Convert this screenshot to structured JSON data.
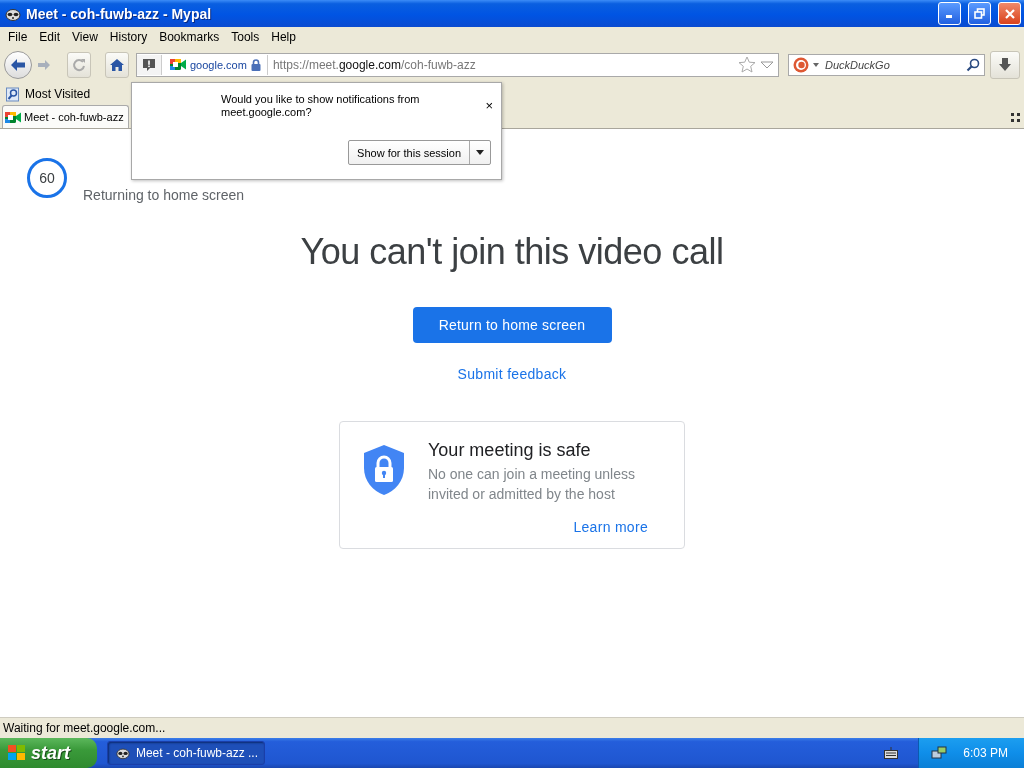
{
  "window": {
    "title": "Meet - coh-fuwb-azz - Mypal"
  },
  "menu": [
    "File",
    "Edit",
    "View",
    "History",
    "Bookmarks",
    "Tools",
    "Help"
  ],
  "navigation": {
    "identity": "google.com",
    "url": "https://meet.**google.com**/coh-fuwb-azz",
    "search": {
      "placeholder": "DuckDuckGo"
    }
  },
  "bookmarks": [
    "Most Visited"
  ],
  "tabs": [
    {
      "label": "Meet - coh-fuwb-azz",
      "selected": true
    }
  ],
  "notification_popup": {
    "message": "Would you like to show notifications from meet.google.com?",
    "close": "×",
    "button": "Show for this session"
  },
  "page": {
    "countdown": "60",
    "countdown_label": "Returning to home screen",
    "heading": "You can't join this video call",
    "primary_button": "Return to home screen",
    "feedback_link": "Submit feedback",
    "card": {
      "title": "Your meeting is safe",
      "body": "No one can join a meeting unless invited or admitted by the host",
      "link": "Learn more"
    }
  },
  "status_bar": "Waiting for meet.google.com...",
  "taskbar": {
    "start": "start",
    "tasks": [
      {
        "label": "Meet - coh-fuwb-azz ...",
        "selected": true
      }
    ],
    "clock": "6:03 PM"
  }
}
